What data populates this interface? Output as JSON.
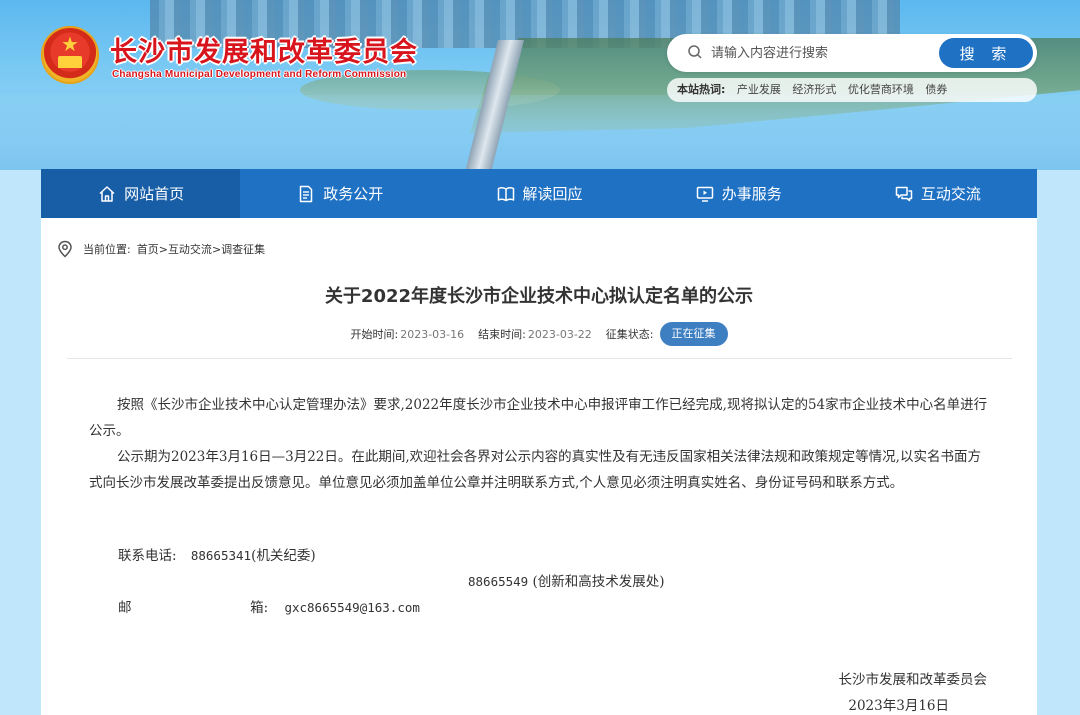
{
  "header": {
    "title": "长沙市发展和改革委员会",
    "subtitle": "Changsha Municipal Development and Reform Commission"
  },
  "search": {
    "placeholder": "请输入内容进行搜索",
    "button_label": "搜 索",
    "hot_label": "本站热词:",
    "hot_words": [
      "产业发展",
      "经济形式",
      "优化营商环境",
      "债券"
    ]
  },
  "nav": {
    "items": [
      {
        "label": "网站首页",
        "icon": "home-icon",
        "active": true
      },
      {
        "label": "政务公开",
        "icon": "document-icon",
        "active": false
      },
      {
        "label": "解读回应",
        "icon": "book-icon",
        "active": false
      },
      {
        "label": "办事服务",
        "icon": "monitor-icon",
        "active": false
      },
      {
        "label": "互动交流",
        "icon": "chat-icon",
        "active": false
      }
    ]
  },
  "breadcrumb": {
    "prefix": "当前位置:",
    "items": [
      "首页",
      "互动交流",
      "调查征集"
    ],
    "separator": ">"
  },
  "article": {
    "title": "关于2022年度长沙市企业技术中心拟认定名单的公示",
    "start_label": "开始时间:",
    "start_value": "2023-03-16",
    "end_label": "结束时间:",
    "end_value": "2023-03-22",
    "status_label": "征集状态:",
    "status_value": "正在征集",
    "paragraphs": [
      "按照《长沙市企业技术中心认定管理办法》要求,2022年度长沙市企业技术中心申报评审工作已经完成,现将拟认定的54家市企业技术中心名单进行公示。",
      "公示期为2023年3月16日—3月22日。在此期间,欢迎社会各界对公示内容的真实性及有无违反国家相关法律法规和政策规定等情况,以实名书面方式向长沙市发展改革委提出反馈意见。单位意见必须加盖单位公章并注明联系方式,个人意见必须注明真实姓名、身份证号码和联系方式。"
    ],
    "contact": {
      "phone_label": "联系电话:",
      "phone1": "88665341",
      "phone1_note": "(机关纪委)",
      "phone2": "88665549",
      "phone2_note": "(创新和高技术发展处)",
      "email_label_1": "邮",
      "email_label_2": "箱:",
      "email": "gxc8665549@163.com"
    },
    "signature": "长沙市发展和改革委员会",
    "date": "2023年3月16日"
  },
  "colors": {
    "nav_bg": "#1f71c4",
    "nav_active": "#175ea7",
    "badge": "#3e7fc1",
    "title_red": "#d8151d",
    "page_bg": "#bfe6fb"
  }
}
